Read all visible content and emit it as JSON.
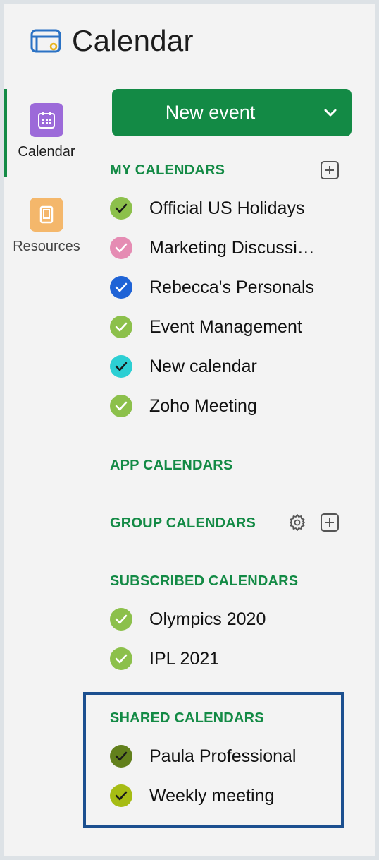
{
  "app": {
    "title": "Calendar",
    "logo_icon": "calendar-logo-icon"
  },
  "rail": {
    "items": [
      {
        "label": "Calendar",
        "icon": "calendar-grid-icon",
        "color": "#9c6ad9",
        "active": true
      },
      {
        "label": "Resources",
        "icon": "door-icon",
        "color": "#f4b76b",
        "active": false
      }
    ]
  },
  "new_event": {
    "label": "New event",
    "dropdown_icon": "chevron-down-icon"
  },
  "sections": {
    "my": {
      "title": "MY CALENDARS",
      "items": [
        {
          "label": "Official US Holidays",
          "color": "#8cc04b",
          "check": "#1a1a1a"
        },
        {
          "label": "Marketing Discussi…",
          "color": "#e58cb3",
          "check": "#ffffff"
        },
        {
          "label": "Rebecca's Personals",
          "color": "#1f63d6",
          "check": "#ffffff"
        },
        {
          "label": "Event Management",
          "color": "#8cc04b",
          "check": "#ffffff"
        },
        {
          "label": "New calendar",
          "color": "#2ccfd3",
          "check": "#1a1a1a"
        },
        {
          "label": "Zoho Meeting",
          "color": "#8cc04b",
          "check": "#ffffff"
        }
      ]
    },
    "app": {
      "title": "APP CALENDARS"
    },
    "group": {
      "title": "GROUP CALENDARS"
    },
    "subscribed": {
      "title": "SUBSCRIBED CALENDARS",
      "items": [
        {
          "label": "Olympics 2020",
          "color": "#8cc04b",
          "check": "#ffffff"
        },
        {
          "label": "IPL 2021",
          "color": "#8cc04b",
          "check": "#ffffff"
        }
      ]
    },
    "shared": {
      "title": "SHARED CALENDARS",
      "items": [
        {
          "label": "Paula Professional",
          "color": "#62801c",
          "check": "#1a1a1a"
        },
        {
          "label": "Weekly meeting",
          "color": "#a6bc14",
          "check": "#1a1a1a"
        }
      ]
    }
  }
}
